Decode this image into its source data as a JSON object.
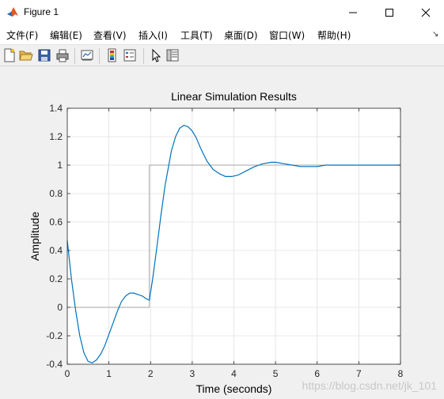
{
  "window": {
    "title": "Figure 1"
  },
  "menu": {
    "items": [
      "文件(F)",
      "编辑(E)",
      "查看(V)",
      "插入(I)",
      "工具(T)",
      "桌面(D)",
      "窗口(W)",
      "帮助(H)"
    ]
  },
  "toolbar": {
    "buttons": [
      "new-figure-icon",
      "open-file-icon",
      "save-icon",
      "print-icon",
      "link-plot-icon",
      "insert-colorbar-icon",
      "insert-legend-icon",
      "edit-plot-arrow-icon",
      "property-inspector-icon"
    ]
  },
  "colors": {
    "response_line": "#0072bd",
    "input_line": "#a6a6a6",
    "grid": "#e0e0e0",
    "axes": "#262626"
  },
  "watermark": "https://blog.csdn.net/jk_101",
  "chart_data": {
    "type": "line",
    "title": "Linear Simulation Results",
    "xlabel": "Time (seconds)",
    "ylabel": "Amplitude",
    "xlim": [
      0,
      8
    ],
    "ylim": [
      -0.4,
      1.4
    ],
    "xticks": [
      0,
      1,
      2,
      3,
      4,
      5,
      6,
      7,
      8
    ],
    "yticks": [
      -0.4,
      -0.2,
      0,
      0.2,
      0.4,
      0.6,
      0.8,
      1,
      1.2,
      1.4
    ],
    "grid": true,
    "series": [
      {
        "role": "input",
        "x": [
          0,
          1.97,
          1.97,
          8
        ],
        "y": [
          0,
          0,
          1,
          1
        ]
      },
      {
        "role": "response",
        "x": [
          0,
          0.1,
          0.2,
          0.3,
          0.4,
          0.5,
          0.6,
          0.7,
          0.8,
          0.9,
          1.0,
          1.1,
          1.2,
          1.3,
          1.4,
          1.5,
          1.6,
          1.7,
          1.8,
          1.9,
          1.97,
          2.05,
          2.15,
          2.25,
          2.35,
          2.5,
          2.6,
          2.7,
          2.8,
          2.9,
          3.0,
          3.1,
          3.2,
          3.35,
          3.5,
          3.65,
          3.8,
          3.95,
          4.1,
          4.3,
          4.5,
          4.7,
          4.9,
          5.0,
          5.2,
          5.4,
          5.6,
          5.8,
          6.0,
          6.2,
          6.5,
          6.8,
          7.1,
          7.5,
          8.0
        ],
        "y": [
          0.47,
          0.2,
          -0.02,
          -0.2,
          -0.32,
          -0.38,
          -0.39,
          -0.37,
          -0.33,
          -0.27,
          -0.19,
          -0.11,
          -0.03,
          0.04,
          0.08,
          0.1,
          0.1,
          0.09,
          0.08,
          0.06,
          0.05,
          0.2,
          0.42,
          0.65,
          0.86,
          1.1,
          1.2,
          1.26,
          1.28,
          1.27,
          1.24,
          1.19,
          1.12,
          1.03,
          0.97,
          0.94,
          0.92,
          0.92,
          0.93,
          0.96,
          0.99,
          1.01,
          1.02,
          1.02,
          1.01,
          1.0,
          0.99,
          0.99,
          0.99,
          1.0,
          1.0,
          1.0,
          1.0,
          1.0,
          1.0
        ]
      }
    ]
  }
}
